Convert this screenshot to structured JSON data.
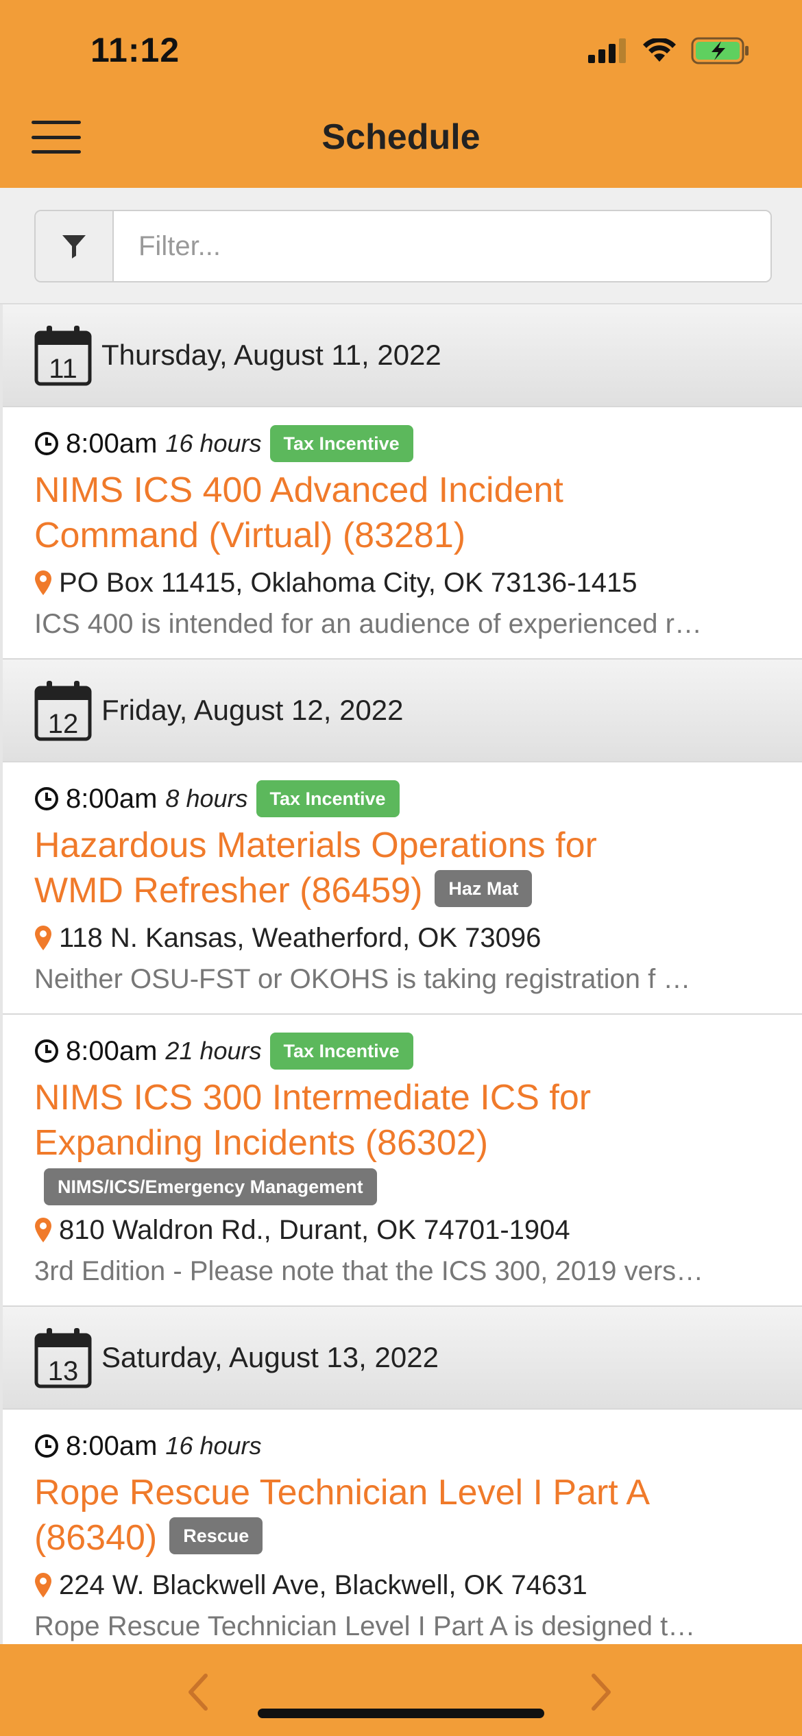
{
  "status_bar": {
    "time": "11:12"
  },
  "header": {
    "title": "Schedule"
  },
  "filter": {
    "placeholder": "Filter..."
  },
  "days": [
    {
      "day_num": "11",
      "date": "Thursday, August 11, 2022",
      "events": [
        {
          "time": "8:00am",
          "duration": "16 hours",
          "badge": "Tax Incentive",
          "title_lines": [
            "NIMS ICS 400 Advanced Incident",
            "Command (Virtual) (83281)"
          ],
          "category": "",
          "address": "PO Box 11415, Oklahoma City, OK 73136-1415",
          "description": "ICS 400 is intended for an audience of experienced r…"
        }
      ]
    },
    {
      "day_num": "12",
      "date": "Friday, August 12, 2022",
      "events": [
        {
          "time": "8:00am",
          "duration": "8 hours",
          "badge": "Tax Incentive",
          "title_lines": [
            "Hazardous Materials Operations for",
            "WMD Refresher (86459)"
          ],
          "category": "Haz Mat",
          "address": "118 N. Kansas, Weatherford, OK 73096",
          "description": " Neither OSU-FST or OKOHS is taking registration f …"
        },
        {
          "time": "8:00am",
          "duration": "21 hours",
          "badge": "Tax Incentive",
          "title_lines": [
            "NIMS ICS 300 Intermediate ICS for",
            "Expanding Incidents (86302)"
          ],
          "category": "NIMS/ICS/Emergency Management",
          "address": "810 Waldron Rd., Durant, OK 74701-1904",
          "description": "3rd Edition - Please note that the ICS 300, 2019 vers…"
        }
      ]
    },
    {
      "day_num": "13",
      "date": "Saturday, August 13, 2022",
      "events": [
        {
          "time": "8:00am",
          "duration": "16 hours",
          "badge": "",
          "title_lines": [
            "Rope Rescue Technician Level I Part A",
            "(86340)"
          ],
          "category": "Rescue",
          "address": "224 W. Blackwell Ave, Blackwell, OK 74631",
          "description": "Rope Rescue Technician Level I Part A is designed t…"
        }
      ]
    }
  ],
  "colors": {
    "header": "#F29D38",
    "title": "#F07A2A",
    "badge_green": "#5CB85C",
    "badge_gray": "#777777"
  },
  "icons": {
    "menu": "hamburger-icon",
    "filter": "funnel-icon",
    "calendar": "calendar-icon",
    "clock": "clock-icon",
    "location": "map-pin-icon",
    "prev": "chevron-left-icon",
    "next": "chevron-right-icon"
  }
}
